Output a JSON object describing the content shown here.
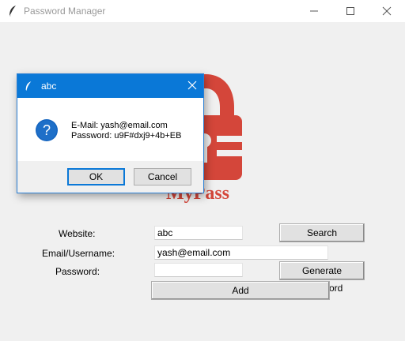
{
  "window": {
    "title": "Password Manager",
    "icon": "feather-icon",
    "controls": [
      "minimize-icon",
      "maximize-icon",
      "close-icon"
    ]
  },
  "logo": {
    "text": "MyPass",
    "color": "#d4463a"
  },
  "form": {
    "website_label": "Website:",
    "website_value": "abc",
    "email_label": "Email/Username:",
    "email_value": "yash@email.com",
    "password_label": "Password:",
    "password_value": "",
    "search_label": "Search",
    "generate_label": "Generate Password",
    "add_label": "Add"
  },
  "dialog": {
    "title": "abc",
    "icon": "question-icon",
    "line1": "E-Mail: yash@email.com",
    "line2": "Password: u9F#dxj9+4b+EB",
    "ok_label": "OK",
    "cancel_label": "Cancel",
    "accent": "#0a78d7"
  }
}
